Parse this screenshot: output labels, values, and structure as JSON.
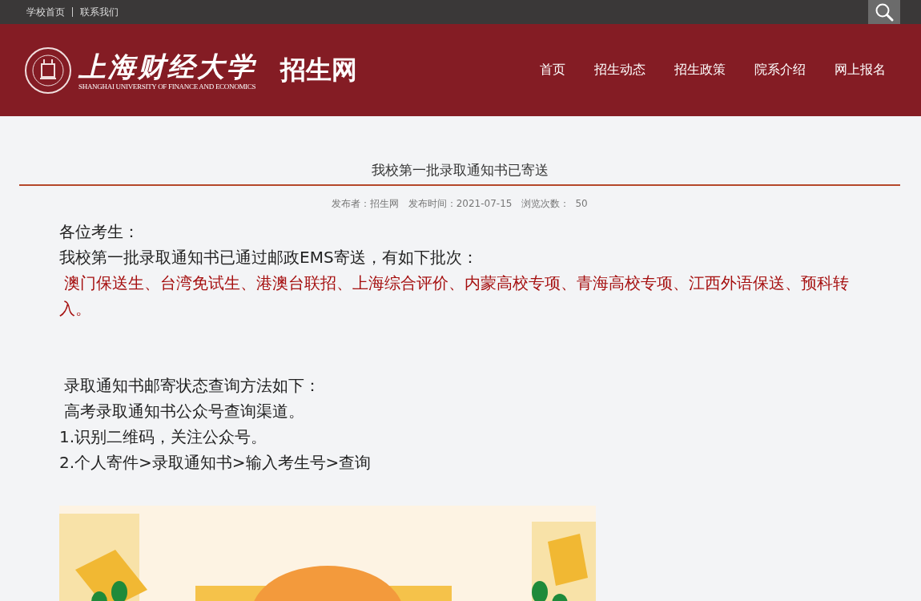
{
  "top_links": [
    "学校首页",
    "联系我们"
  ],
  "logo": {
    "name": "上海财经大学",
    "english": "SHANGHAI UNIVERSITY OF FINANCE AND ECONOMICS",
    "site": "招生网"
  },
  "nav": [
    "首页",
    "招生动态",
    "招生政策",
    "院系介绍",
    "网上报名"
  ],
  "article": {
    "title": "我校第一批录取通知书已寄送",
    "meta": "发布者：招生网   发布时间：2021-07-15   浏览次数：  50",
    "sections": [
      [
        {
          "kind": "normal",
          "text": "各位考生："
        },
        {
          "kind": "normal",
          "text": "我校第一批录取通知书已通过邮政EMS寄送，有如下批次："
        },
        {
          "kind": "highlight",
          "text": " 澳门保送生、台湾免试生、港澳台联招、上海综合评价、内蒙高校专项、青海高校专项、江西外语保送、预科转入。"
        }
      ],
      [
        {
          "kind": "normal",
          "text": " 录取通知书邮寄状态查询方法如下："
        },
        {
          "kind": "normal",
          "text": " 高考录取通知书公众号查询渠道。"
        },
        {
          "kind": "normal",
          "text": "1.识别二维码，关注公众号。"
        },
        {
          "kind": "normal",
          "text": "2.个人寄件>录取通知书>输入考生号>查询"
        }
      ]
    ],
    "image": {
      "kind": "picture"
    }
  }
}
